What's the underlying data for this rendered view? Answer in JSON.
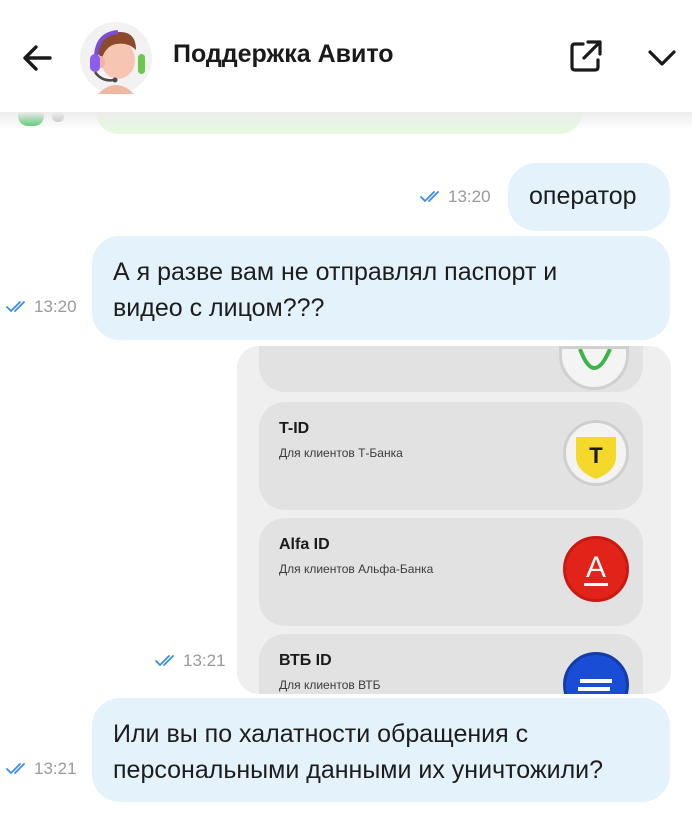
{
  "header": {
    "title": "Поддержка Авито"
  },
  "messages": [
    {
      "text": "оператор",
      "time": "13:20",
      "status": "read"
    },
    {
      "line1": "А я разве вам не отправлял паспорт и",
      "line2": "видео с лицом???",
      "time": "13:20",
      "status": "read"
    },
    {
      "type": "image",
      "time": "13:21",
      "status": "read"
    },
    {
      "line1": "Или вы по халатности обращения с",
      "line2": "персональными данными их уничтожили?",
      "time": "13:21",
      "status": "read"
    }
  ],
  "image_cards": [
    {
      "title": "T-ID",
      "subtitle": "Для клиентов Т-Банка",
      "logo_letter": "T",
      "color": "#f5d92a"
    },
    {
      "title": "Alfa ID",
      "subtitle": "Для клиентов Альфа-Банка",
      "logo_letter": "А",
      "color": "#e2231a"
    },
    {
      "title": "ВТБ ID",
      "subtitle": "Для клиентов ВТБ",
      "logo_letter": "",
      "color": "#1a4dd6"
    }
  ],
  "colors": {
    "outgoing_bubble": "#e4f2fc",
    "read_check": "#3a8ee8",
    "timestamp": "#9a9a9a"
  },
  "icons": [
    "back-arrow-icon",
    "support-avatar",
    "share-icon",
    "chevron-down-icon",
    "double-check-icon"
  ]
}
